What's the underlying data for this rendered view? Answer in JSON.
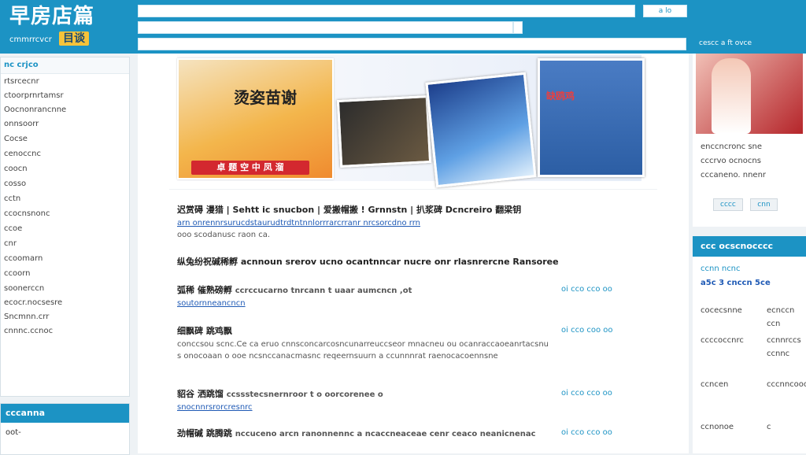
{
  "header": {
    "logo_title": "早房店篇",
    "logo_sub": "cmmrrcvcr",
    "logo_badge": "目谈",
    "mini_button": "a lo",
    "mini_button2": "",
    "top_right": "cescc a ft ovce"
  },
  "left": {
    "heading": "nc crjco",
    "items": [
      "rtsrcecnr",
      "ctoorprnrtamsr",
      "Oocnonrancnne",
      "onnsoorr",
      "Cocse",
      "cenoccnc",
      "coocn",
      "cosso",
      "cctn",
      "ccocnsnonc",
      "ccoe",
      "cnr",
      "ccoomarn",
      "ccoorn",
      "soonerccn",
      "ecocr.nocsesre",
      "Sncmnn.crr",
      "cnnnc.ccnoc"
    ],
    "panel2_heading": "cccanna",
    "panel2_item": "oot-"
  },
  "banner": {
    "poster_title": "烫姿苗谢",
    "poster_button": "卓 题 空 中 凤 溜",
    "photo3_title": "缺鸥鸡"
  },
  "main": {
    "article": {
      "title": "迟赏碍 漫猎 | Sehtt ic snucbon | 爱搬帽搬 ! Grnnstn | 扒浆碑  Dcncreiro 翻梁钥",
      "line1_link": "arn onrennrsurucdstaurudtrdtntnnlorrrarcrranr nrcsorcdno rrn",
      "line2": "ooo scodanusc raon ca."
    },
    "rows": [
      {
        "title": "纵兔纷祝碱稀孵 acnnoun srerov ucno ocantnncar nucre onr rlasnrercne  Ransoree"
      },
      {
        "title": "弧稀 催熟磅孵",
        "text": "ccrccucarno tnrcann t uaar aumcncn ,ot",
        "link": "soutornneancncn",
        "meta": "oi  cco  cco  oo"
      },
      {
        "title": "细飘碑 跳鸡飘",
        "text": "conccsou scnc.Ce ca eruo cnnsconcarcosncunarreuccseor mnacneu ou ocanraccaoeanrtacsnu s onocoaan  o ooe ncsnccanacmasnc reqeernsuurn a ccunnnrat raenocacoennsne",
        "meta": "oi  cco  coo  oo"
      },
      {
        "title": "貂谷 洒跳馏",
        "text": "ccssstecsnernroor t o oorcorenee o",
        "link": "snocnnrsrorcresnrc",
        "meta": "oi  cco  cco  oo"
      },
      {
        "title": "劲帽碱 跳腾跳",
        "text": "nccuceno arcn ranonnennc a ncaccneaceae cenr ceaco neanicnenac",
        "meta": "oi  cco  cco  oo"
      }
    ]
  },
  "right": {
    "lines": [
      "enccncronc sne",
      "cccrvo ocnocns",
      "cccaneno. nnenr"
    ],
    "buttons": [
      "cccc",
      "cnn"
    ],
    "heading": "ccc  ocscnocccc",
    "sub": "ccnn ncnc",
    "sub2": "a5c 3 cnccn 5ce",
    "rows": [
      {
        "k": "cocecsnne",
        "v": "ecnccn ccn"
      },
      {
        "k": "ccccoccnrc",
        "v": "ccnnrccs ccnnc"
      },
      {
        "k": "ccncen",
        "v": "cccnncoocs"
      },
      {
        "k": "ccnonoe",
        "v": "c"
      }
    ]
  }
}
